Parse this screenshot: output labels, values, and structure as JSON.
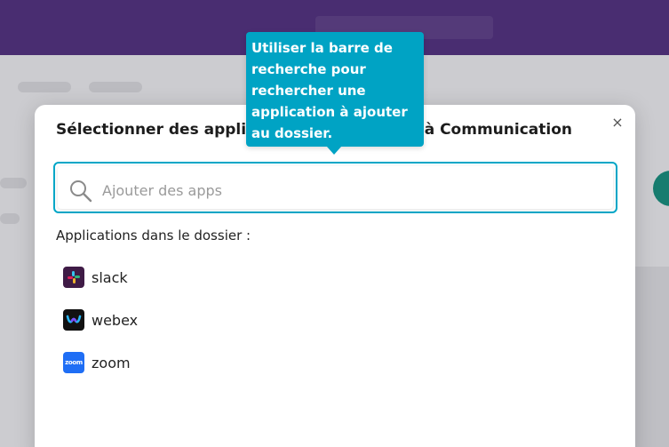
{
  "modal": {
    "title": "Sélectionner des applications pour ajouter à Communication",
    "close_label": "×",
    "search": {
      "placeholder": "Ajouter des apps",
      "value": ""
    },
    "section_label": "Applications dans le dossier :",
    "apps": [
      {
        "name": "slack",
        "icon": "slack-logo"
      },
      {
        "name": "webex",
        "icon": "webex-logo"
      },
      {
        "name": "zoom",
        "icon": "zoom-logo",
        "logo_text": "zoom"
      }
    ]
  },
  "tooltip": {
    "lines": [
      "Utiliser la barre de",
      "recherche pour",
      "rechercher une",
      "application à ajouter",
      "au dossier."
    ]
  },
  "colors": {
    "accent": "#00a6c7",
    "tooltip": "#00a3c4",
    "header": "#4c2a7a"
  }
}
